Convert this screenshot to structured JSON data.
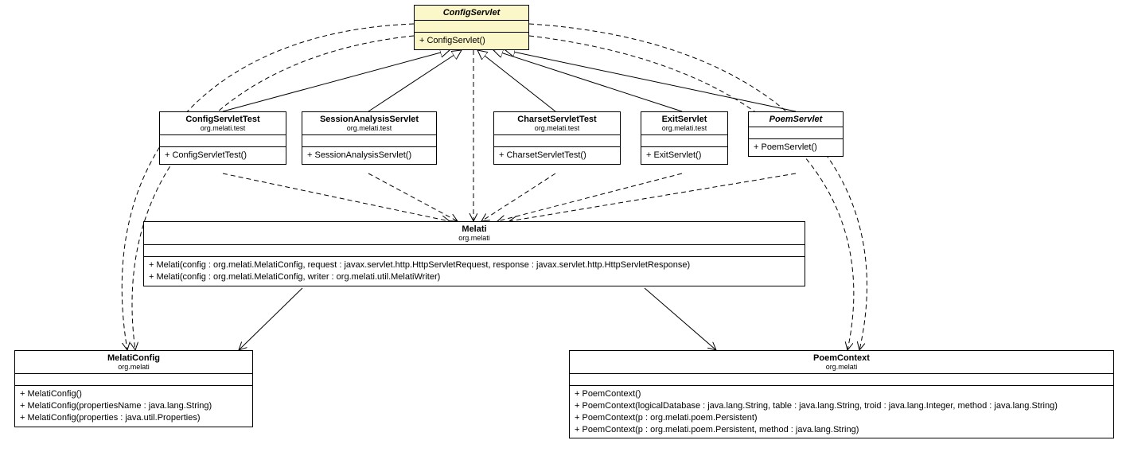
{
  "classes": {
    "configServlet": {
      "name": "ConfigServlet",
      "abstract": true,
      "ops": [
        "+ ConfigServlet()"
      ]
    },
    "configServletTest": {
      "name": "ConfigServletTest",
      "pkg": "org.melati.test",
      "ops": [
        "+ ConfigServletTest()"
      ]
    },
    "sessionAnalysisServlet": {
      "name": "SessionAnalysisServlet",
      "pkg": "org.melati.test",
      "ops": [
        "+ SessionAnalysisServlet()"
      ]
    },
    "charsetServletTest": {
      "name": "CharsetServletTest",
      "pkg": "org.melati.test",
      "ops": [
        "+ CharsetServletTest()"
      ]
    },
    "exitServlet": {
      "name": "ExitServlet",
      "pkg": "org.melati.test",
      "ops": [
        "+ ExitServlet()"
      ]
    },
    "poemServlet": {
      "name": "PoemServlet",
      "abstract": true,
      "ops": [
        "+ PoemServlet()"
      ]
    },
    "melati": {
      "name": "Melati",
      "pkg": "org.melati",
      "ops": [
        "+ Melati(config : org.melati.MelatiConfig, request : javax.servlet.http.HttpServletRequest, response : javax.servlet.http.HttpServletResponse)",
        "+ Melati(config : org.melati.MelatiConfig, writer : org.melati.util.MelatiWriter)"
      ]
    },
    "melatiConfig": {
      "name": "MelatiConfig",
      "pkg": "org.melati",
      "ops": [
        "+ MelatiConfig()",
        "+ MelatiConfig(propertiesName : java.lang.String)",
        "+ MelatiConfig(properties : java.util.Properties)"
      ]
    },
    "poemContext": {
      "name": "PoemContext",
      "pkg": "org.melati",
      "ops": [
        "+ PoemContext()",
        "+ PoemContext(logicalDatabase : java.lang.String, table : java.lang.String, troid : java.lang.Integer, method : java.lang.String)",
        "+ PoemContext(p : org.melati.poem.Persistent)",
        "+ PoemContext(p : org.melati.poem.Persistent, method : java.lang.String)"
      ]
    }
  }
}
